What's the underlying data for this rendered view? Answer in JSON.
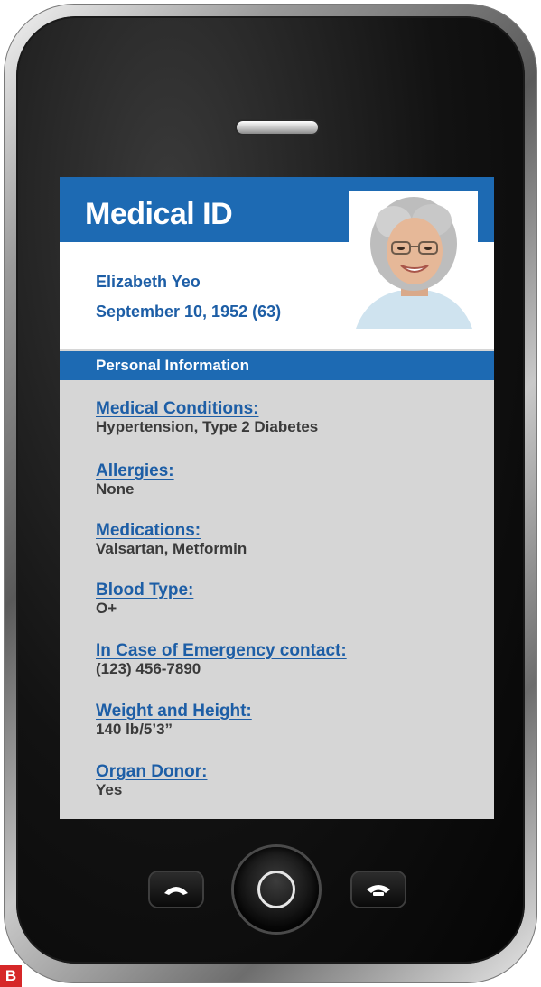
{
  "app": {
    "title": "Medical ID"
  },
  "patient": {
    "name": "Elizabeth Yeo",
    "dob": "September 10, 1952 (63)"
  },
  "section": {
    "title": "Personal Information"
  },
  "fields": [
    {
      "label": "Medical Conditions:",
      "value": "Hypertension, Type 2 Diabetes"
    },
    {
      "label": "Allergies:",
      "value": "None"
    },
    {
      "label": "Medications:",
      "value": "Valsartan, Metformin"
    },
    {
      "label": "Blood Type:",
      "value": "O+"
    },
    {
      "label": "In Case of Emergency contact:",
      "value": "(123) 456-7890"
    },
    {
      "label": "Weight and Height:",
      "value": "140 lb/5’3”"
    },
    {
      "label": "Organ Donor:",
      "value": "Yes"
    }
  ],
  "figure_label": "B",
  "colors": {
    "brand_blue": "#1d6ab3",
    "label_blue": "#1d5ea6",
    "screen_bg": "#d6d6d6",
    "value_text": "#3a3a3a",
    "figure_label_bg": "#d62728"
  },
  "icons": {
    "avatar": "person-photo",
    "call": "phone-answer-icon",
    "hangup": "phone-hangup-icon",
    "home": "home-button-ring"
  }
}
